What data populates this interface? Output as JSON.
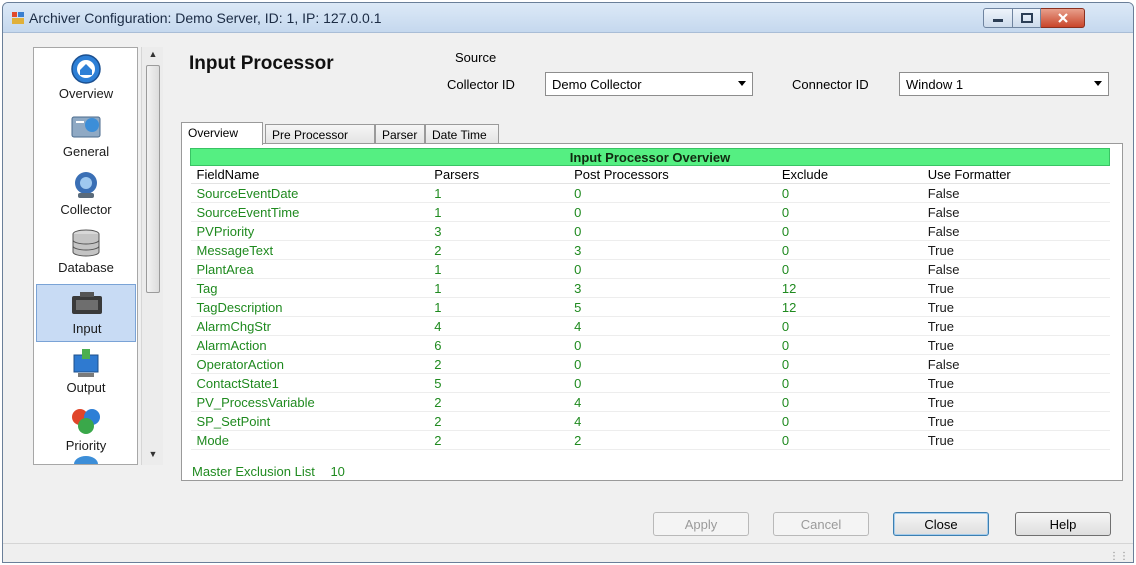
{
  "window": {
    "title": "Archiver Configuration: Demo Server, ID: 1, IP: 127.0.0.1"
  },
  "nav": {
    "items": [
      {
        "label": "Overview",
        "icon": "overview-icon"
      },
      {
        "label": "General",
        "icon": "general-icon"
      },
      {
        "label": "Collector",
        "icon": "collector-icon"
      },
      {
        "label": "Database",
        "icon": "database-icon"
      },
      {
        "label": "Input",
        "icon": "input-icon",
        "selected": true
      },
      {
        "label": "Output",
        "icon": "output-icon"
      },
      {
        "label": "Priority",
        "icon": "priority-icon"
      }
    ]
  },
  "page": {
    "heading": "Input Processor"
  },
  "source": {
    "label": "Source",
    "collector_label": "Collector ID",
    "collector_value": "Demo Collector",
    "connector_label": "Connector ID",
    "connector_value": "Window 1"
  },
  "tabs": [
    "Overview",
    "Pre Processor",
    "Parser",
    "Date Time"
  ],
  "grid": {
    "caption": "Input Processor Overview",
    "columns": [
      "FieldName",
      "Parsers",
      "Post Processors",
      "Exclude",
      "Use Formatter"
    ],
    "rows": [
      [
        "SourceEventDate",
        "1",
        "0",
        "0",
        "False"
      ],
      [
        "SourceEventTime",
        "1",
        "0",
        "0",
        "False"
      ],
      [
        "PVPriority",
        "3",
        "0",
        "0",
        "False"
      ],
      [
        "MessageText",
        "2",
        "3",
        "0",
        "True"
      ],
      [
        "PlantArea",
        "1",
        "0",
        "0",
        "False"
      ],
      [
        "Tag",
        "1",
        "3",
        "12",
        "True"
      ],
      [
        "TagDescription",
        "1",
        "5",
        "12",
        "True"
      ],
      [
        "AlarmChgStr",
        "4",
        "4",
        "0",
        "True"
      ],
      [
        "AlarmAction",
        "6",
        "0",
        "0",
        "True"
      ],
      [
        "OperatorAction",
        "2",
        "0",
        "0",
        "False"
      ],
      [
        "ContactState1",
        "5",
        "0",
        "0",
        "True"
      ],
      [
        "PV_ProcessVariable",
        "2",
        "4",
        "0",
        "True"
      ],
      [
        "SP_SetPoint",
        "2",
        "4",
        "0",
        "True"
      ],
      [
        "Mode",
        "2",
        "2",
        "0",
        "True"
      ]
    ]
  },
  "master_exclusion": {
    "label": "Master Exclusion List",
    "count": "10"
  },
  "buttons": {
    "apply": "Apply",
    "cancel": "Cancel",
    "close": "Close",
    "help": "Help"
  },
  "colors": {
    "caption_bg": "#55ef82",
    "value_text": "#1f8a1f",
    "selected_nav": "#c8dbf4"
  }
}
